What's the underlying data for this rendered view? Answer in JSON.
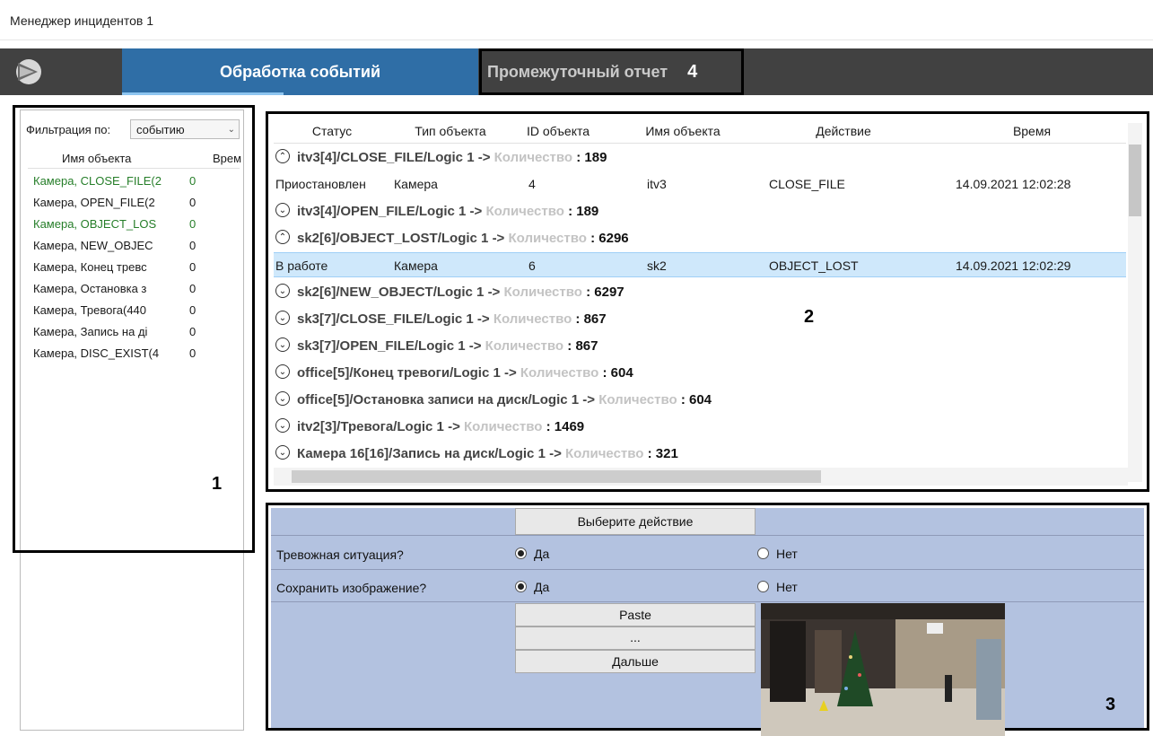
{
  "window": {
    "title": "Менеджер инцидентов 1"
  },
  "toolbar": {
    "logo": "play-logo-icon",
    "tab_active": "Обработка событий",
    "tab_report": "Промежуточный отчет",
    "marker4": "4"
  },
  "left_panel": {
    "filter_label": "Фильтрация по:",
    "filter_value": "событию",
    "col_name": "Имя объекта",
    "col_time": "Врем",
    "rows": [
      {
        "name": "Камера, CLOSE_FILE(2",
        "value": "0",
        "green": true
      },
      {
        "name": "Камера, OPEN_FILE(2",
        "value": "0",
        "green": false
      },
      {
        "name": "Камера, OBJECT_LOS",
        "value": "0",
        "green": true
      },
      {
        "name": "Камера, NEW_OBJEC",
        "value": "0",
        "green": false
      },
      {
        "name": "Камера, Конец тревс",
        "value": "0",
        "green": false
      },
      {
        "name": "Камера, Остановка з",
        "value": "0",
        "green": false
      },
      {
        "name": "Камера, Тревога(440",
        "value": "0",
        "green": false
      },
      {
        "name": "Камера, Запись на ді",
        "value": "0",
        "green": false
      },
      {
        "name": "Камера, DISC_EXIST(4",
        "value": "0",
        "green": false
      }
    ],
    "marker1": "1"
  },
  "events": {
    "columns": [
      "Статус",
      "Тип объекта",
      "ID объекта",
      "Имя объекта",
      "Действие",
      "Время"
    ],
    "qty_label": "Количество",
    "g0": {
      "text": "itv3[4]/CLOSE_FILE/Logic 1",
      "count": "189",
      "chev": "up"
    },
    "r0": {
      "status": "Приостановлен",
      "type": "Камера",
      "id": "4",
      "name": "itv3",
      "action": "CLOSE_FILE",
      "time": "14.09.2021 12:02:28"
    },
    "g1": {
      "text": "itv3[4]/OPEN_FILE/Logic 1",
      "count": "189",
      "chev": "down"
    },
    "g2": {
      "text": "sk2[6]/OBJECT_LOST/Logic 1",
      "count": "6296",
      "chev": "up"
    },
    "r1": {
      "status": "В работе",
      "type": "Камера",
      "id": "6",
      "name": "sk2",
      "action": "OBJECT_LOST",
      "time": "14.09.2021 12:02:29"
    },
    "g3": {
      "text": "sk2[6]/NEW_OBJECT/Logic 1",
      "count": "6297",
      "chev": "down"
    },
    "g4": {
      "text": "sk3[7]/CLOSE_FILE/Logic 1",
      "count": "867",
      "chev": "down"
    },
    "g5": {
      "text": "sk3[7]/OPEN_FILE/Logic 1",
      "count": "867",
      "chev": "down"
    },
    "g6": {
      "text": "office[5]/Конец тревоги/Logic 1",
      "count": "604",
      "chev": "down"
    },
    "g7": {
      "text": "office[5]/Остановка записи на диск/Logic 1",
      "count": "604",
      "chev": "down"
    },
    "g8": {
      "text": "itv2[3]/Тревога/Logic 1",
      "count": "1469",
      "chev": "down"
    },
    "g9": {
      "text": "Камера 16[16]/Запись на диск/Logic 1",
      "count": "321",
      "chev": "down"
    },
    "arrow": "->",
    "marker2": "2"
  },
  "actions": {
    "select_action": "Выберите действие",
    "alarm_q": "Тревожная ситуация?",
    "save_q": "Сохранить изображение?",
    "yes": "Да",
    "no": "Нет",
    "alarm_selected": "yes",
    "save_selected": "yes",
    "paste": "Paste",
    "ellipsis": "...",
    "next": "Дальше",
    "marker3": "3"
  }
}
